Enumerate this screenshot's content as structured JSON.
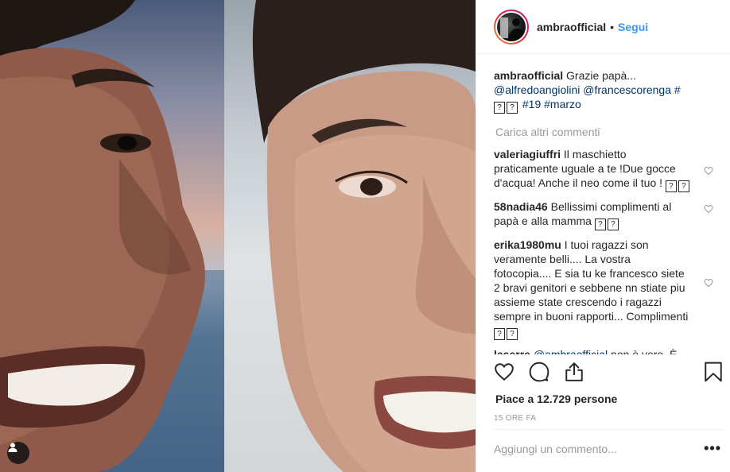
{
  "post": {
    "author": "ambraofficial",
    "follow_label": "Segui",
    "separator": "•",
    "caption_text": "Grazie papà...",
    "caption_mentions": [
      "@alfredoangiolini",
      "@francescorenga",
      "#"
    ],
    "caption_hashtags": [
      "#19",
      "#marzo"
    ],
    "load_more": "Carica altri commenti",
    "comments": [
      {
        "user": "valeriagiuffri",
        "text": "Il maschietto praticamente uguale a te !Due gocce d'acqua! Anche il neo come il tuo !"
      },
      {
        "user": "58nadia46",
        "text": "Bellissimi complimenti al papà e alla mamma"
      },
      {
        "user": "erika1980mu",
        "text": "I tuoi ragazzi son veramente belli.... La vostra fotocopia.... E sia tu ke francesco siete 2 bravi genitori e sebbene nn stiate piu assieme state crescendo i ragazzi sempre in buoni rapporti... Complimenti"
      },
      {
        "user": "laserre",
        "mention": "@ambraofficial",
        "text": "non è vero. È"
      }
    ],
    "likes": "Piace a 12.729 persone",
    "time": "15 ORE FA",
    "add_comment_placeholder": "Aggiungi un commento...",
    "more_options": "•••",
    "emoji_box": "?"
  },
  "icons": {
    "like": "heart-icon",
    "comment": "comment-bubble-icon",
    "share": "share-icon",
    "save": "bookmark-icon",
    "user_tag": "user-icon"
  },
  "colors": {
    "link_blue": "#3897f0",
    "mention_blue": "#003569",
    "muted": "#999999",
    "text": "#262626"
  }
}
